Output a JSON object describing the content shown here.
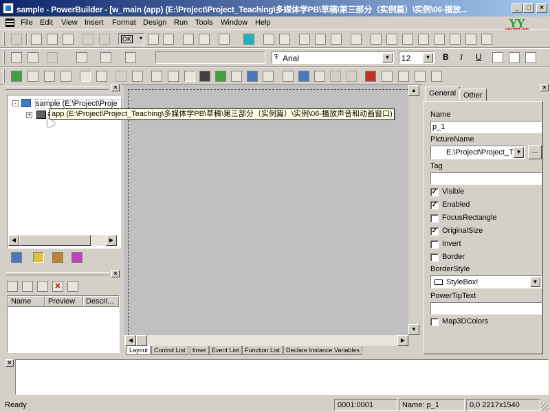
{
  "window": {
    "title": "sample - PowerBuilder - [w_main (app) (E:\\Project\\Project_Teaching\\多媒体学PB\\草稿\\第三部分（实例篇）\\实例\\06-播放...",
    "logo_text": "YY",
    "logo_subtext": "育碟苑",
    "minimize": "_",
    "maximize": "□",
    "close": "×"
  },
  "menu": {
    "items": [
      "File",
      "Edit",
      "View",
      "Insert",
      "Format",
      "Design",
      "Run",
      "Tools",
      "Window",
      "Help"
    ],
    "window_controls": {
      "minimize": "_",
      "restore": "❐",
      "close": "×"
    }
  },
  "toolbar_format": {
    "style_combo": "",
    "font_combo": "Arial",
    "font_prefix_icon": "truetype-icon",
    "size_combo": "12",
    "bold": "B",
    "italic": "I",
    "underline": "U",
    "ok_button": "OK"
  },
  "system_tree": {
    "root_label": "sample (E:\\Project\\Proje",
    "child_label": "app",
    "tooltip": "app (E:\\Project\\Project_Teaching\\多媒体学PB\\草稿\\第三部分（实例篇）\\实例\\06-播放声音和动画窗口)",
    "expander_root": "-",
    "expander_child": "+"
  },
  "clip_panel": {
    "columns": [
      "Name",
      "Preview",
      "Descri..."
    ]
  },
  "layout_tabs": [
    "Layout",
    "Control List",
    "timer",
    "Event List",
    "Function List",
    "Declare Instance Variables"
  ],
  "properties": {
    "tabs": [
      "General",
      "Other"
    ],
    "name_label": "Name",
    "name_value": "p_1",
    "picturename_label": "PictureName",
    "picturename_value": "E:\\Project\\Project_T",
    "browse_button": "...",
    "tag_label": "Tag",
    "tag_value": "",
    "checkboxes": [
      {
        "label": "Visible",
        "checked": true
      },
      {
        "label": "Enabled",
        "checked": true
      },
      {
        "label": "FocusRectangle",
        "checked": false
      },
      {
        "label": "OriginalSize",
        "checked": true
      },
      {
        "label": "Invert",
        "checked": false
      },
      {
        "label": "Border",
        "checked": false
      }
    ],
    "borderstyle_label": "BorderStyle",
    "borderstyle_value": "StyleBox!",
    "powertip_label": "PowerTipText",
    "powertip_value": "",
    "map3d": {
      "label": "Map3DColors",
      "checked": false
    }
  },
  "output_panel": {
    "close": "×"
  },
  "statusbar": {
    "ready": "Ready",
    "position": "0001:0001",
    "name": "Name: p_1",
    "coords": "0,0 2217x1540"
  }
}
